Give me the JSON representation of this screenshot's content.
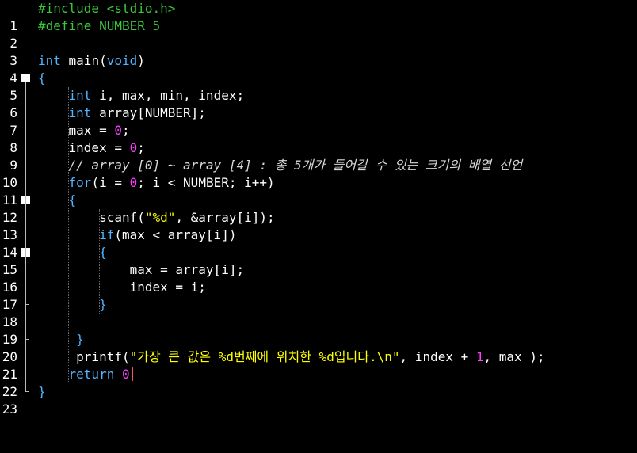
{
  "editor": {
    "lines": [
      {
        "no": "1",
        "text": "#include <stdio.h>"
      },
      {
        "no": "2",
        "text": "#define NUMBER 5"
      },
      {
        "no": "3",
        "text": ""
      },
      {
        "no": "4",
        "text": "int main(void)"
      },
      {
        "no": "5",
        "text": "{"
      },
      {
        "no": "6",
        "text": "    int i, max, min, index;"
      },
      {
        "no": "7",
        "text": "    int array[NUMBER];"
      },
      {
        "no": "8",
        "text": "    max = 0;"
      },
      {
        "no": "9",
        "text": "    index = 0;"
      },
      {
        "no": "10",
        "text": "    // array [0] ~ array [4] : 총 5개가 들어갈 수 있는 크기의 배열 선언"
      },
      {
        "no": "11",
        "text": "    for(i = 0; i < NUMBER; i++)"
      },
      {
        "no": "12",
        "text": "    {"
      },
      {
        "no": "13",
        "text": "        scanf(\"%d\", &array[i]);"
      },
      {
        "no": "14",
        "text": "        if(max < array[i])"
      },
      {
        "no": "15",
        "text": "        {"
      },
      {
        "no": "16",
        "text": "            max = array[i];"
      },
      {
        "no": "17",
        "text": "            index = i;"
      },
      {
        "no": "18",
        "text": "        }"
      },
      {
        "no": "19",
        "text": ""
      },
      {
        "no": "20",
        "text": "     }"
      },
      {
        "no": "21",
        "text": "     printf(\"가장 큰 값은 %d번째에 위치한 %d입니다.\\n\", index + 1, max );"
      },
      {
        "no": "22",
        "text": "    return 0"
      },
      {
        "no": "23",
        "text": "}"
      }
    ]
  },
  "colors": {
    "background": "#000000",
    "keyword": "#50b4ff",
    "preprocessor": "#3cc83c",
    "number": "#ff3cff",
    "string": "#ffff00",
    "comment": "#d8d8d8",
    "text": "#ffffff"
  }
}
